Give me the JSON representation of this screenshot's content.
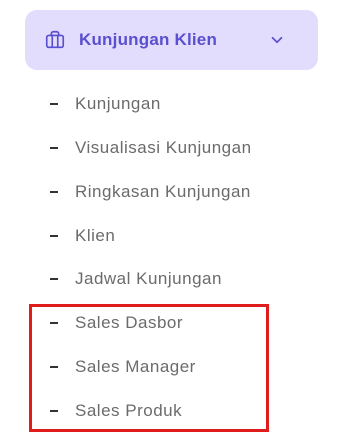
{
  "menu_group": {
    "label": "Kunjungan Klien",
    "icon": "briefcase-icon",
    "toggle_icon": "chevron-down-icon",
    "expanded": true,
    "colors": {
      "background": "#e2dcfd",
      "accent": "#5a4fcf"
    }
  },
  "sub_items": [
    {
      "label": "Kunjungan"
    },
    {
      "label": "Visualisasi Kunjungan"
    },
    {
      "label": "Ringkasan Kunjungan"
    },
    {
      "label": "Klien"
    },
    {
      "label": "Jadwal Kunjungan"
    },
    {
      "label": "Sales Dasbor"
    },
    {
      "label": "Sales Manager"
    },
    {
      "label": "Sales Produk"
    }
  ],
  "annotation": {
    "type": "highlight-rectangle",
    "color": "#e01b1b",
    "highlighted_items": [
      "Sales Dasbor",
      "Sales Manager",
      "Sales Produk"
    ]
  }
}
